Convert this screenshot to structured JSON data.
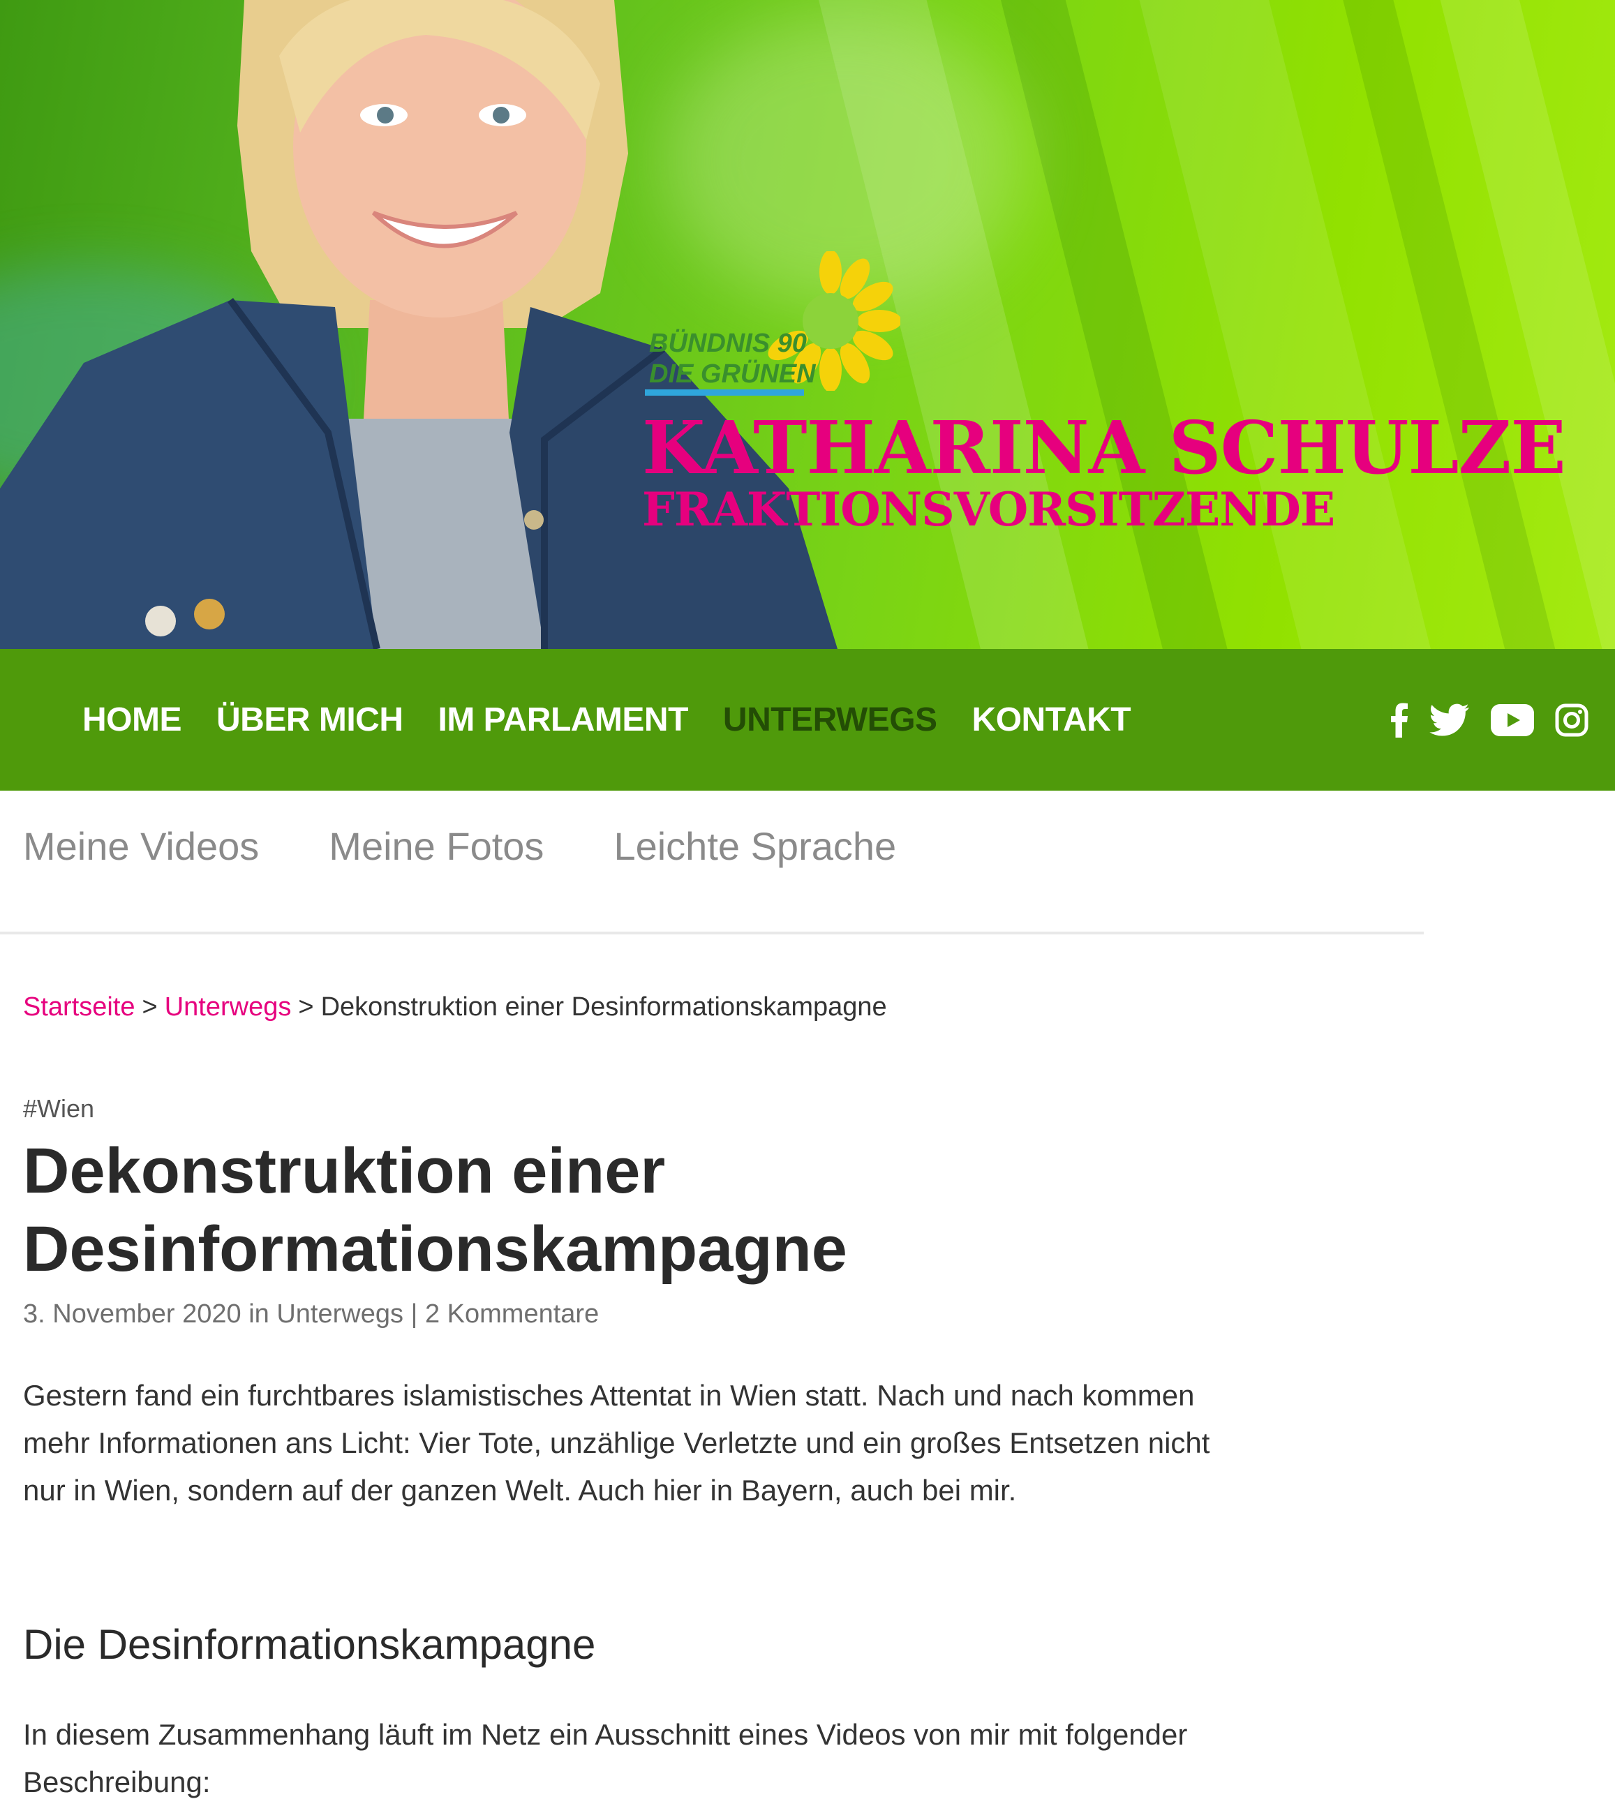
{
  "header": {
    "party_line1": "BÜNDNIS 90",
    "party_line2": "DIE GRÜNEN",
    "name": "KATHARINA SCHULZE",
    "role": "FRAKTIONSVORSITZENDE"
  },
  "nav": {
    "items": [
      {
        "label": "HOME"
      },
      {
        "label": "ÜBER MICH"
      },
      {
        "label": "IM PARLAMENT"
      },
      {
        "label": "UNTERWEGS",
        "active": true
      },
      {
        "label": "KONTAKT"
      }
    ],
    "social_icons": [
      "facebook-icon",
      "twitter-icon",
      "youtube-icon",
      "instagram-icon"
    ]
  },
  "subnav": {
    "items": [
      {
        "label": "Meine Videos"
      },
      {
        "label": "Meine Fotos"
      },
      {
        "label": "Leichte Sprache"
      }
    ]
  },
  "breadcrumb": {
    "home": "Startseite",
    "section": "Unterwegs",
    "current": "Dekonstruktion einer Desinformationskampagne",
    "separator": ">"
  },
  "article": {
    "tag": "#Wien",
    "title": "Dekonstruktion einer Desinformationskampagne",
    "meta": {
      "date": "3. November 2020",
      "in": "in",
      "category": "Unterwegs",
      "divider": "|",
      "comments": "2 Kommentare"
    },
    "intro": "Gestern fand ein furchtbares islamistisches Attentat in Wien statt. Nach und nach kommen mehr Informationen ans Licht: Vier Tote, unzählige Verletzte und ein großes Entsetzen nicht nur in Wien, sondern auf der ganzen Welt. Auch hier in Bayern, auch bei mir.",
    "section_heading": "Die Desinformationskampagne",
    "paragraph2": "In diesem Zusammenhang läuft im Netz ein Ausschnitt eines Videos von mir mit folgender Beschreibung:"
  },
  "colors": {
    "nav_green": "#4f9a0b",
    "accent_magenta": "#e6007e",
    "active_nav": "#234d05"
  }
}
